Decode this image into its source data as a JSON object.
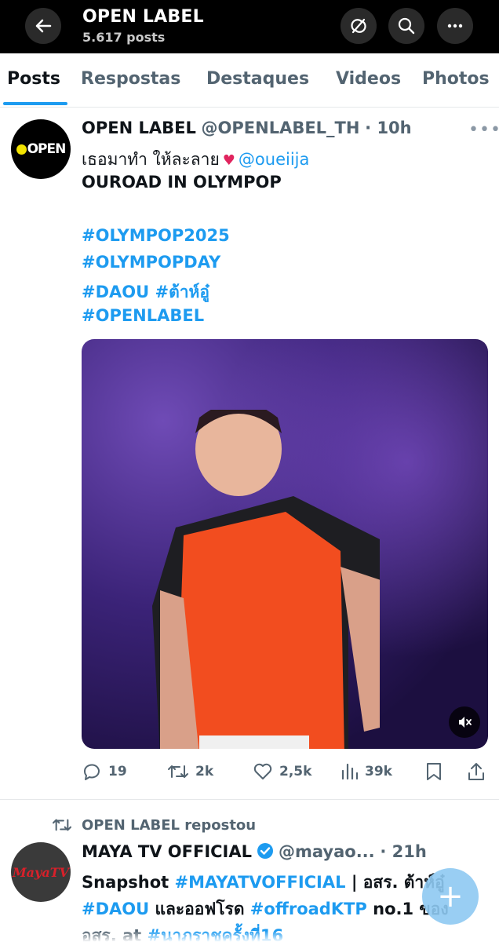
{
  "header": {
    "title": "OPEN LABEL",
    "posts_count": "5.617 posts",
    "icons": [
      "arrow-left-icon",
      "sync-off-icon",
      "search-icon",
      "more-icon"
    ]
  },
  "tabs": [
    {
      "label": "Posts",
      "active": true
    },
    {
      "label": "Respostas",
      "active": false
    },
    {
      "label": "Destaques",
      "active": false
    },
    {
      "label": "Videos",
      "active": false
    },
    {
      "label": "Photos",
      "active": false
    }
  ],
  "post1": {
    "avatar_text": "OPEN",
    "name": "OPEN LABEL",
    "handle": "@OPENLABEL_TH",
    "time": "· 10h",
    "text_thai": "เธอมาทำ ให้ละลาย",
    "mention": "@oueiija",
    "line2": "OUROAD IN OLYMPOP",
    "hashtags": [
      "#OLYMPOP2025",
      "#OLYMPOPDAY",
      "#DAOU",
      "#ต้าห์อู๋",
      "#OPENLABEL"
    ],
    "stats": {
      "replies": "19",
      "reposts": "2k",
      "likes": "2,5k",
      "views": "39k"
    }
  },
  "post2": {
    "repost_label": "OPEN LABEL repostou",
    "avatar_text": "MayaTV",
    "name": "MAYA TV OFFICIAL",
    "handle": "@mayao...",
    "time": "· 21h",
    "l1_a": "Snapshot",
    "l1_tag": "#MAYATVOFFICIAL",
    "l1_b": "| อสร. ต้าห์อู๋",
    "l2_tag1": "#DAOU",
    "l2_a": "และออฟโรด",
    "l2_tag2": "#offroadKTP",
    "l2_b": "no.1 ของ",
    "l3_a": "อสร. at",
    "l3_tag": "#นาภราชครั้งที่16"
  },
  "colors": {
    "accent": "#1d9bf0",
    "muted": "#536471",
    "text": "#0f1419"
  }
}
